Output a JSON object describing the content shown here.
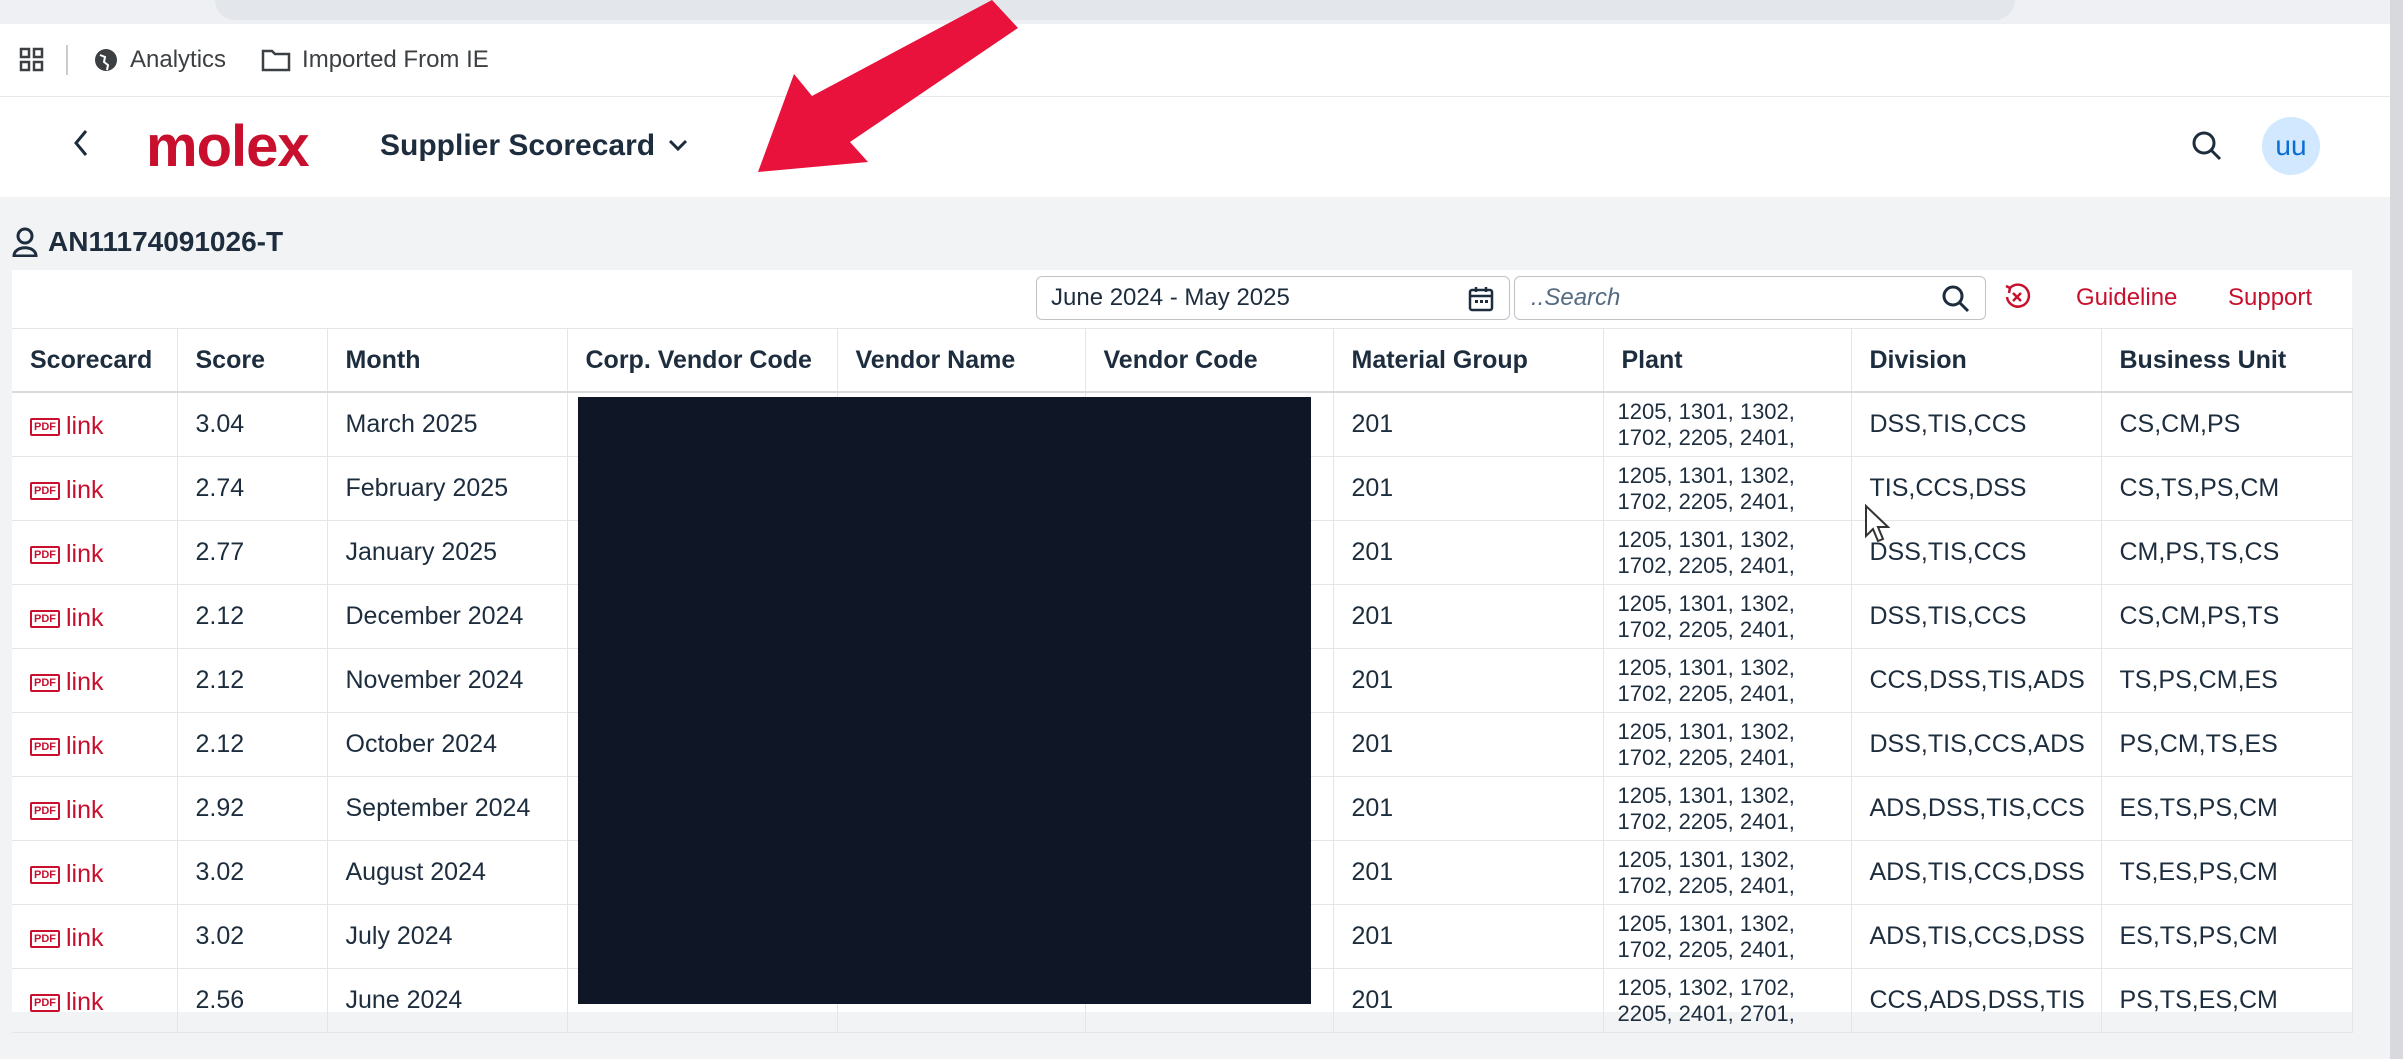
{
  "bookmarks": {
    "analytics": "Analytics",
    "imported": "Imported From IE"
  },
  "shell": {
    "logo": "molex",
    "title": "Supplier Scorecard",
    "avatar": "uu"
  },
  "vendor": {
    "id": "AN11174091026-T"
  },
  "toolbar": {
    "date_range": "June 2024 - May 2025",
    "search_placeholder": "..Search",
    "guideline": "Guideline",
    "support": "Support"
  },
  "table": {
    "columns": [
      "Scorecard",
      "Score",
      "Month",
      "Corp. Vendor Code",
      "Vendor Name",
      "Vendor Code",
      "Material Group",
      "Plant",
      "Division",
      "Business Unit"
    ],
    "link_label": "link",
    "pdf_badge": "PDF",
    "rows": [
      {
        "score": "3.04",
        "month": "March 2025",
        "material": "201",
        "plant_1": "1205, 1301, 1302,",
        "plant_2": "1702, 2205, 2401,",
        "division": "DSS,TIS,CCS",
        "bu": "CS,CM,PS"
      },
      {
        "score": "2.74",
        "month": "February 2025",
        "material": "201",
        "plant_1": "1205, 1301, 1302,",
        "plant_2": "1702, 2205, 2401,",
        "division": "TIS,CCS,DSS",
        "bu": "CS,TS,PS,CM"
      },
      {
        "score": "2.77",
        "month": "January 2025",
        "material": "201",
        "plant_1": "1205, 1301, 1302,",
        "plant_2": "1702, 2205, 2401,",
        "division": "DSS,TIS,CCS",
        "bu": "CM,PS,TS,CS"
      },
      {
        "score": "2.12",
        "month": "December 2024",
        "material": "201",
        "plant_1": "1205, 1301, 1302,",
        "plant_2": "1702, 2205, 2401,",
        "division": "DSS,TIS,CCS",
        "bu": "CS,CM,PS,TS"
      },
      {
        "score": "2.12",
        "month": "November 2024",
        "material": "201",
        "plant_1": "1205, 1301, 1302,",
        "plant_2": "1702, 2205, 2401,",
        "division": "CCS,DSS,TIS,ADS",
        "bu": "TS,PS,CM,ES"
      },
      {
        "score": "2.12",
        "month": "October 2024",
        "material": "201",
        "plant_1": "1205, 1301, 1302,",
        "plant_2": "1702, 2205, 2401,",
        "division": "DSS,TIS,CCS,ADS",
        "bu": "PS,CM,TS,ES"
      },
      {
        "score": "2.92",
        "month": "September 2024",
        "material": "201",
        "plant_1": "1205, 1301, 1302,",
        "plant_2": "1702, 2205, 2401,",
        "division": "ADS,DSS,TIS,CCS",
        "bu": "ES,TS,PS,CM"
      },
      {
        "score": "3.02",
        "month": "August 2024",
        "material": "201",
        "plant_1": "1205, 1301, 1302,",
        "plant_2": "1702, 2205, 2401,",
        "division": "ADS,TIS,CCS,DSS",
        "bu": "TS,ES,PS,CM"
      },
      {
        "score": "3.02",
        "month": "July 2024",
        "material": "201",
        "plant_1": "1205, 1301, 1302,",
        "plant_2": "1702, 2205, 2401,",
        "division": "ADS,TIS,CCS,DSS",
        "bu": "ES,TS,PS,CM"
      },
      {
        "score": "2.56",
        "month": "June 2024",
        "material": "201",
        "plant_1": "1205, 1302, 1702,",
        "plant_2": "2205, 2401, 2701,",
        "division": "CCS,ADS,DSS,TIS",
        "bu": "PS,TS,ES,CM"
      }
    ]
  },
  "colors": {
    "brand": "#c8102e",
    "text": "#1d2d3e",
    "avatar_bg": "#d1e8ff",
    "redaction": "#0f1626",
    "arrow": "#e8123c"
  },
  "icons": [
    "apps-grid-icon",
    "globe-icon",
    "folder-icon",
    "back-chevron-icon",
    "chevron-down-icon",
    "search-icon",
    "user-icon",
    "calendar-icon",
    "reset-icon",
    "pdf-icon",
    "cursor-icon",
    "annotation-arrow-icon"
  ]
}
